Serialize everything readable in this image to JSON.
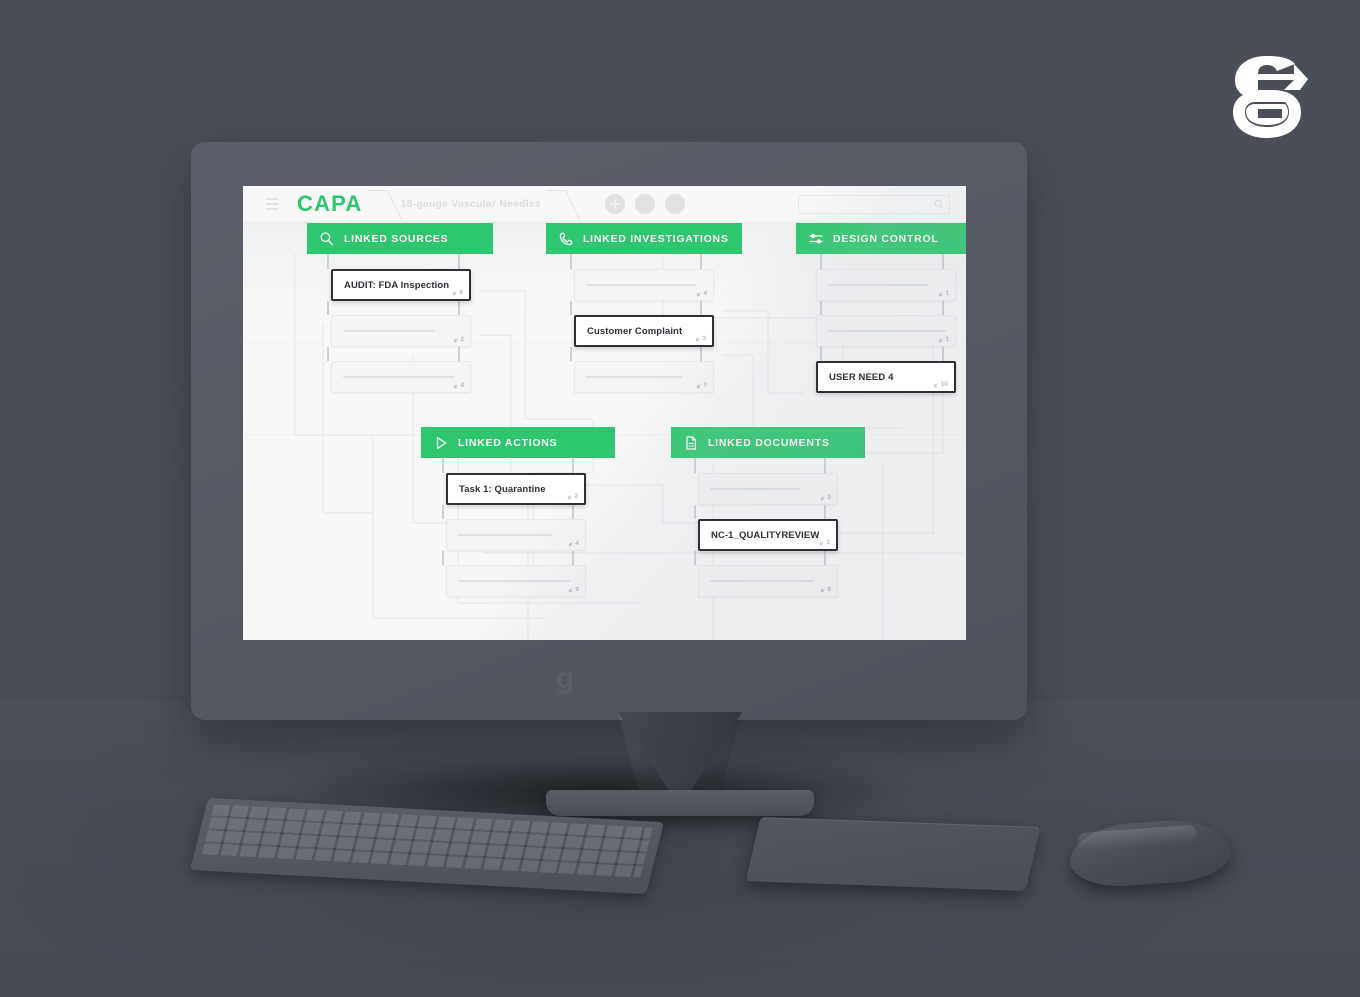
{
  "brand": {
    "logo_name": "g-logo"
  },
  "app": {
    "logo_text": "CAPA",
    "breadcrumb": "18-gauge Vascular Needles",
    "menu_icon": "hamburger-icon",
    "header_actions": [
      {
        "name": "add-circle",
        "icon": "plus-icon"
      },
      {
        "name": "action-circle-2",
        "icon": "blank-circle-icon"
      },
      {
        "name": "action-circle-3",
        "icon": "blank-circle-icon"
      }
    ],
    "search": {
      "value": "",
      "placeholder": "",
      "icon": "search-icon"
    }
  },
  "colors": {
    "accent_green": "#2ecc71",
    "node_border_active": "#2d3036",
    "desk_gray": "#4a4e57",
    "monitor_gray": "#575b64"
  },
  "diagram": {
    "groups": [
      {
        "id": "linked-sources",
        "title": "LINKED SOURCES",
        "icon": "magnifier-icon",
        "nodes": [
          {
            "title": "AUDIT: FDA Inspection",
            "badge": "8",
            "highlight": true
          },
          {
            "title": "",
            "badge": "2",
            "highlight": false
          },
          {
            "title": "",
            "badge": "4",
            "highlight": false
          }
        ]
      },
      {
        "id": "linked-investigations",
        "title": "LINKED INVESTIGATIONS",
        "icon": "phone-icon",
        "nodes": [
          {
            "title": "",
            "badge": "4",
            "highlight": false
          },
          {
            "title": "Customer Complaint",
            "badge": "3",
            "highlight": true
          },
          {
            "title": "",
            "badge": "7",
            "highlight": false
          }
        ]
      },
      {
        "id": "design-control",
        "title": "DESIGN CONTROL",
        "icon": "sliders-icon",
        "nodes": [
          {
            "title": "",
            "badge": "1",
            "highlight": false
          },
          {
            "title": "",
            "badge": "1",
            "highlight": false
          },
          {
            "title": "USER NEED 4",
            "badge": "10",
            "highlight": true
          }
        ]
      },
      {
        "id": "linked-actions",
        "title": "LINKED ACTIONS",
        "icon": "play-icon",
        "nodes": [
          {
            "title": "Task 1: Quarantine",
            "badge": "2",
            "highlight": true
          },
          {
            "title": "",
            "badge": "4",
            "highlight": false
          },
          {
            "title": "",
            "badge": "9",
            "highlight": false
          }
        ]
      },
      {
        "id": "linked-documents",
        "title": "LINKED DOCUMENTS",
        "icon": "document-icon",
        "nodes": [
          {
            "title": "",
            "badge": "3",
            "highlight": false
          },
          {
            "title": "NC-1_QUALITYREVIEW",
            "badge": "3",
            "highlight": true
          },
          {
            "title": "",
            "badge": "8",
            "highlight": false
          }
        ]
      }
    ]
  },
  "peripherals": [
    {
      "name": "keyboard"
    },
    {
      "name": "trackpad"
    },
    {
      "name": "mouse"
    }
  ]
}
